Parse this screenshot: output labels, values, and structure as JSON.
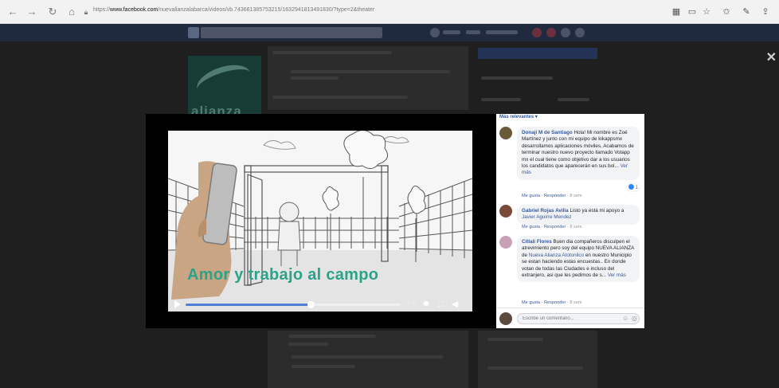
{
  "browser": {
    "url_prefix": "https://",
    "url_host": "www.facebook.com",
    "url_path": "/nuevalianzalabarca/videos/vb.743661385753215/1632941813491830/?type=2&theater",
    "nav_icons": [
      "back-icon",
      "forward-icon",
      "refresh-icon",
      "home-icon",
      "lock-icon"
    ],
    "right_icons": [
      "reading-view-icon",
      "book-icon",
      "favorite-star-icon",
      "favorites-hub-icon",
      "pen-icon",
      "share-icon"
    ]
  },
  "video": {
    "subtitle": "Amor y trabajo al campo",
    "time": "-0:41",
    "progress": 0.58,
    "controls": [
      "play-icon",
      "settings-icon",
      "fullscreen-icon",
      "volume-icon"
    ]
  },
  "comments_panel": {
    "sort_label": "Más relevantes ▾",
    "comments": [
      {
        "author": "Donají M de Santiago",
        "text": "Hola! Mi nombre es Zoé Martínez y junto con mi equipo de kikappsmx desarrollamos aplicaciones móviles. Acabamos de terminar nuestro nuevo proyecto llamado Votapp mx el cual tiene como objetivo dar a los usuarios los candidatos que aparecerán en sus bol...",
        "see_more": "Ver más",
        "reactions": "1",
        "like": "Me gusta",
        "reply": "Responder",
        "time": "8 sem",
        "avatar_color": "#6b5a3a"
      },
      {
        "author": "Gabriel Rojas Avilia",
        "text": "Listo ya está mi apoyo a",
        "mention": "Javier Aguirre Mendez",
        "like": "Me gusta",
        "reply": "Responder",
        "time": "8 sem",
        "avatar_color": "#7a4a38"
      },
      {
        "author": "Citlali Flores",
        "text_before": "Buen dia compañeros disculpen el atrevimiento pero soy del equipo NUEVA ALIANZA de",
        "mention": "Nueva Alianza Atotonilco",
        "text_after": "en nuestro Municipio se estan haciendo estas encuestas.. En donde votan de todas las Ciudades e incluso del extranjero, asi que les pedimos de s...",
        "see_more": "Ver más",
        "like": "Me gusta",
        "reply": "Responder",
        "time": "8 sem",
        "avatar_color": "#c9a0b8"
      }
    ],
    "composer_placeholder": "Escribe un comentario...",
    "composer_icons": [
      "emoji-icon",
      "camera-icon"
    ]
  },
  "background_page": {
    "cover_text": "alianza"
  },
  "colors": {
    "accent_link": "#385898",
    "subtitle": "#2aa389",
    "progress": "#4f80d8"
  }
}
